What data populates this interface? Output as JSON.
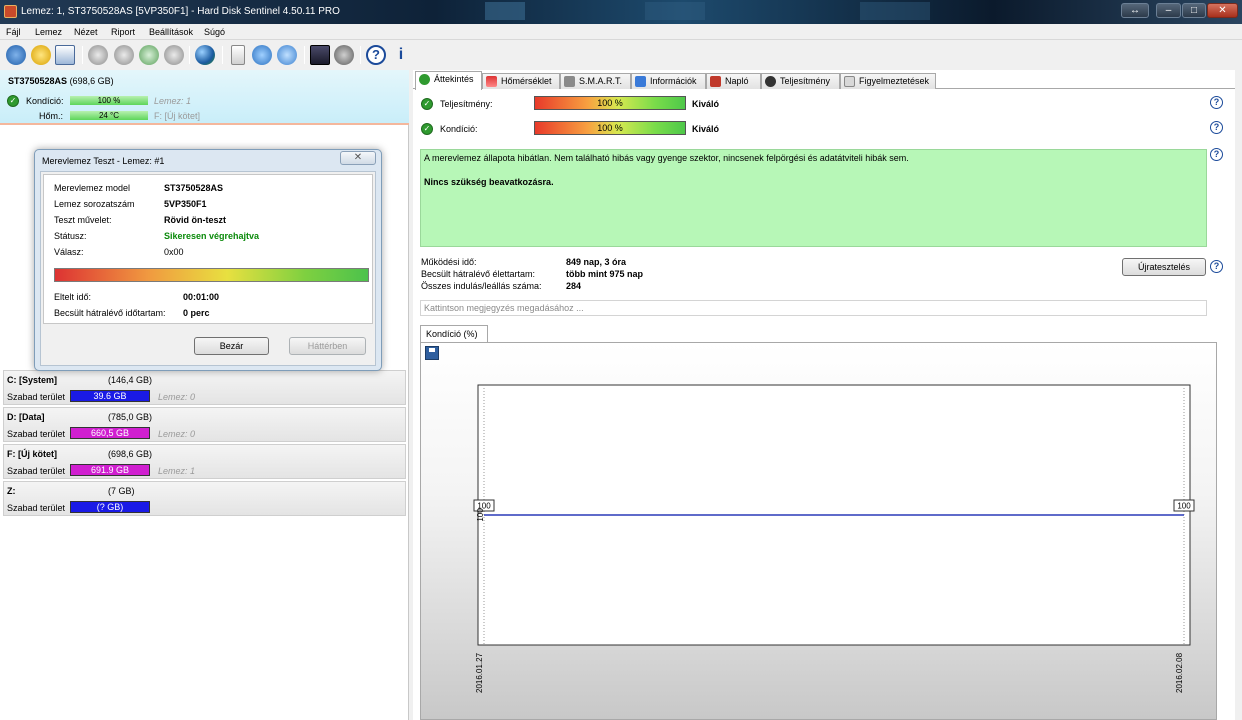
{
  "window": {
    "title": "Lemez: 1, ST3750528AS [5VP350F1]  -  Hard Disk Sentinel 4.50.11 PRO",
    "buttons": {
      "restore": "↔",
      "minimize": "–",
      "maximize": "□",
      "close": "✕"
    }
  },
  "menu": [
    "Fájl",
    "Lemez",
    "Nézet",
    "Riport",
    "Beállítások",
    "Súgó"
  ],
  "toolbar": {
    "icons": [
      "refresh-icon",
      "warning-icon",
      "mail-icon",
      "satellite-icon",
      "satellite2-icon",
      "satellite3-icon",
      "satellite4-icon",
      "globe-icon",
      "copy-icon",
      "sync-icon",
      "transfer-icon",
      "report-icon",
      "settings-icon",
      "help-icon",
      "info-icon"
    ]
  },
  "disk": {
    "name": "ST3750528AS",
    "size": "(698,6 GB)",
    "health_label": "Kondíció:",
    "health_value": "100 %",
    "health_disk": "Lemez: 1",
    "temp_label": "Hőm.:",
    "temp_value": "24 °C",
    "temp_volume": "F: [Új kötet]"
  },
  "dialog": {
    "title": "Merevlemez Teszt - Lemez: #1",
    "close": "✕",
    "rows": [
      {
        "label": "Merevlemez model",
        "value": "ST3750528AS"
      },
      {
        "label": "Lemez sorozatszám",
        "value": "5VP350F1"
      },
      {
        "label": "Teszt művelet:",
        "value": "Rövid ön-teszt"
      },
      {
        "label": "Státusz:",
        "value": "Sikeresen végrehajtva"
      },
      {
        "label": "Válasz:",
        "value": "0x00"
      }
    ],
    "progress": 1.0,
    "elapsed_label": "Eltelt idő:",
    "elapsed_value": "00:01:00",
    "remaining_label": "Becsült hátralévő időtartam:",
    "remaining_value": "0 perc",
    "close_button": "Bezár",
    "background_button": "Háttérben"
  },
  "partitions": [
    {
      "name": "C: [System]",
      "size": "(146,4 GB)",
      "free_label": "Szabad terület",
      "free": "39.6 GB",
      "disk": "Lemez: 0",
      "fill": 0.27,
      "color": "#1a1ae6"
    },
    {
      "name": "D: [Data]",
      "size": "(785,0 GB)",
      "free_label": "Szabad terület",
      "free": "660,5 GB",
      "disk": "Lemez: 0",
      "fill": 0.84,
      "color": "#d01fd0"
    },
    {
      "name": "F: [Új kötet]",
      "size": "(698,6 GB)",
      "free_label": "Szabad terület",
      "free": "691.9 GB",
      "disk": "Lemez: 1",
      "fill": 0.99,
      "color": "#d01fd0"
    },
    {
      "name": "Z:",
      "size": "(7 GB)",
      "free_label": "Szabad terület",
      "free": "(? GB)",
      "disk": "",
      "fill": 0,
      "color": "#1a1ae6"
    }
  ],
  "tabs": [
    "Áttekintés",
    "Hőmérséklet",
    "S.M.A.R.T.",
    "Információk",
    "Napló",
    "Teljesítmény",
    "Figyelmeztetések"
  ],
  "overview": {
    "performance_label": "Teljesítmény:",
    "performance_value": "100 %",
    "performance_text": "Kiváló",
    "health_label": "Kondíció:",
    "health_value": "100 %",
    "health_text": "Kiváló",
    "status_text": "A merevlemez állapota hibátlan. Nem található hibás vagy gyenge szektor, nincsenek felpörgési és adatátviteli hibák sem.",
    "action_text": "Nincs szükség beavatkozásra.",
    "uptime_label": "Működési idő:",
    "uptime_value": "849 nap, 3 óra",
    "lifetime_label": "Becsült hátralévő élettartam:",
    "lifetime_value": "több mint 975 nap",
    "startstop_label": "Összes indulás/leállás száma:",
    "startstop_value": "284",
    "retest_button": "Újratesztelés",
    "comment_placeholder": "Kattintson megjegyzés megadásához ...",
    "chart_tab": "Kondíció  (%)"
  },
  "chart_data": {
    "type": "line",
    "x": [
      "2016.01.27",
      "2016.02.08"
    ],
    "series": [
      {
        "values": [
          100,
          100
        ]
      }
    ],
    "ylabel": "100",
    "point_labels": [
      "100",
      "100"
    ],
    "color": "#2a3ab8"
  }
}
